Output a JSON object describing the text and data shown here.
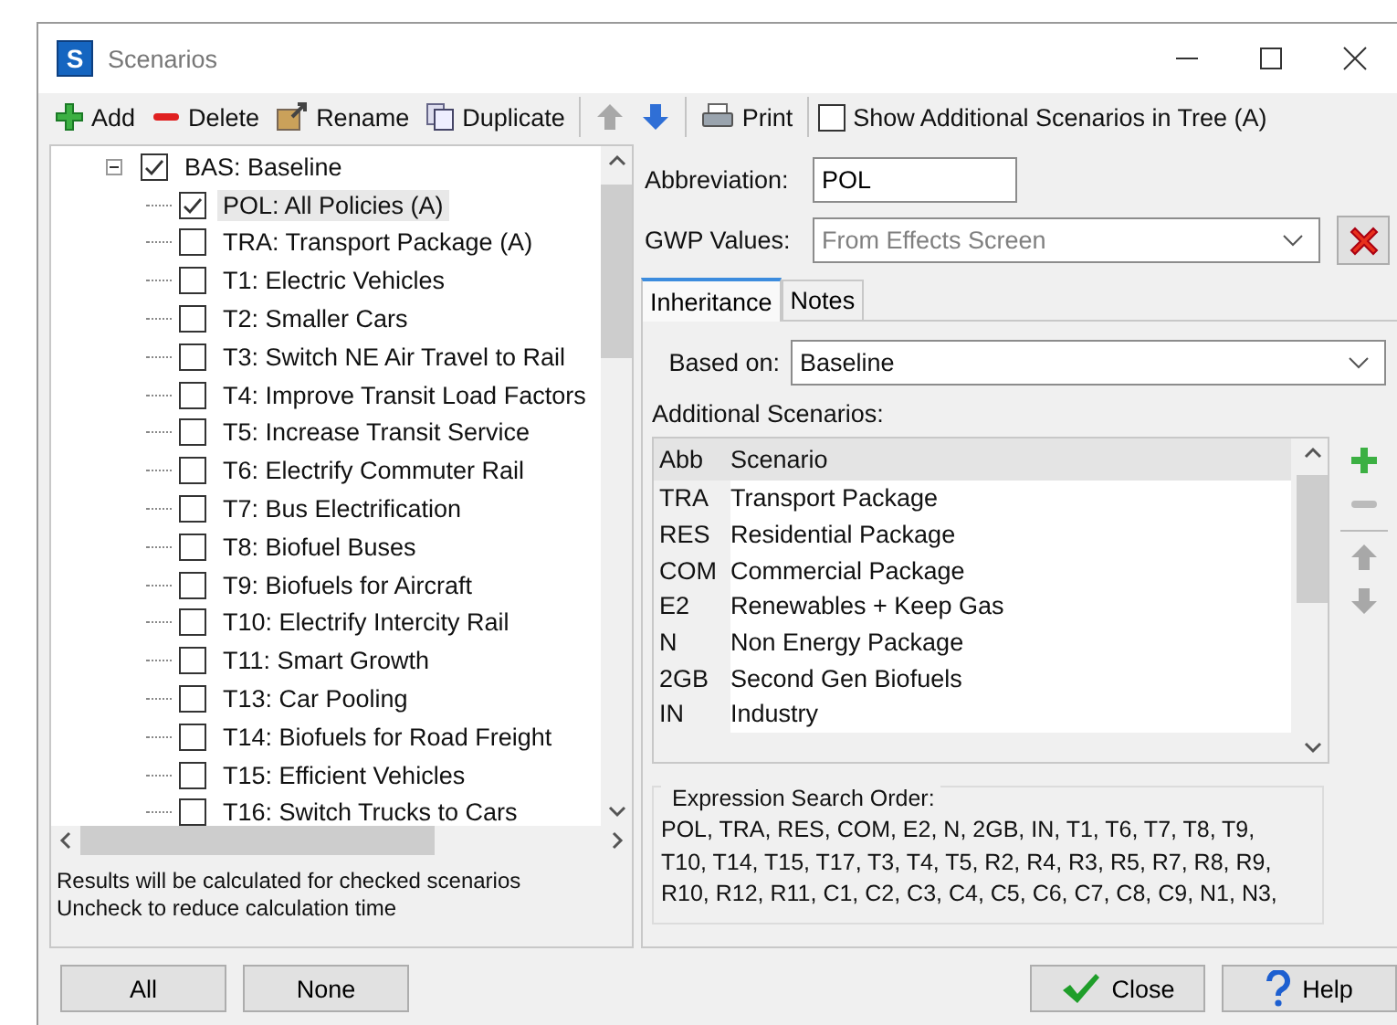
{
  "window": {
    "title": "Scenarios",
    "app_icon": "S"
  },
  "toolbar": [
    {
      "label": "Add",
      "kind": "add",
      "disabled": false
    },
    {
      "label": "Delete",
      "kind": "delete",
      "disabled": false
    },
    {
      "label": "Rename",
      "kind": "rename",
      "disabled": false
    },
    {
      "label": "Duplicate",
      "kind": "duplicate",
      "disabled": false
    },
    {
      "kind": "up",
      "disabled": true
    },
    {
      "kind": "down",
      "disabled": false
    },
    {
      "label": "Print",
      "kind": "print",
      "disabled": false
    }
  ],
  "show_additional": {
    "label": "Show Additional Scenarios in Tree (A)",
    "checked": false
  },
  "tree": [
    {
      "label": "BAS: Baseline",
      "checked": true,
      "expanded": true,
      "children": [
        {
          "label": "POL: All Policies (A)",
          "checked": true,
          "selected": true
        },
        {
          "label": "TRA: Transport Package (A)",
          "checked": false,
          "selected": false
        },
        {
          "label": "T1: Electric Vehicles",
          "checked": false,
          "selected": false
        },
        {
          "label": "T2: Smaller Cars",
          "checked": false,
          "selected": false
        },
        {
          "label": "T3: Switch NE Air Travel to Rail",
          "checked": false,
          "selected": false
        },
        {
          "label": "T4: Improve Transit Load Factors",
          "checked": false,
          "selected": false
        },
        {
          "label": "T5: Increase Transit Service",
          "checked": false,
          "selected": false
        },
        {
          "label": "T6: Electrify Commuter Rail",
          "checked": false,
          "selected": false
        },
        {
          "label": "T7: Bus Electrification",
          "checked": false,
          "selected": false
        },
        {
          "label": "T8: Biofuel Buses",
          "checked": false,
          "selected": false
        },
        {
          "label": "T9: Biofuels for Aircraft",
          "checked": false,
          "selected": false
        },
        {
          "label": "T10: Electrify Intercity Rail",
          "checked": false,
          "selected": false
        },
        {
          "label": "T11: Smart Growth",
          "checked": false,
          "selected": false
        },
        {
          "label": "T13: Car Pooling",
          "checked": false,
          "selected": false
        },
        {
          "label": "T14: Biofuels for Road Freight",
          "checked": false,
          "selected": false
        },
        {
          "label": "T15: Efficient Vehicles",
          "checked": false,
          "selected": false
        },
        {
          "label": "T16: Switch Trucks to Cars",
          "checked": false,
          "selected": false
        }
      ]
    }
  ],
  "tree_note": [
    "Results will be calculated for checked scenarios",
    "Uncheck to reduce calculation time"
  ],
  "select_buttons": [
    "All",
    "None"
  ],
  "abbreviation": {
    "label": "Abbreviation:",
    "value": "POL"
  },
  "gwp": {
    "label": "GWP Values:",
    "placeholder": "From Effects Screen"
  },
  "tabs": [
    {
      "label": "Inheritance",
      "selected": true
    },
    {
      "label": "Notes",
      "selected": false
    }
  ],
  "based_on": {
    "label": "Based on:",
    "value": "Baseline"
  },
  "additional": {
    "label": "Additional Scenarios:",
    "columns": [
      "Abb",
      "Scenario"
    ],
    "rows": [
      [
        "TRA",
        "Transport Package"
      ],
      [
        "RES",
        "Residential Package"
      ],
      [
        "COM",
        "Commercial Package"
      ],
      [
        "E2",
        "Renewables + Keep Gas"
      ],
      [
        "N",
        "Non Energy Package"
      ],
      [
        "2GB",
        "Second Gen Biofuels"
      ],
      [
        "IN",
        "Industry"
      ]
    ],
    "side_buttons": [
      {
        "kind": "add",
        "disabled": false
      },
      {
        "kind": "remove",
        "disabled": true
      },
      {
        "kind": "up",
        "disabled": true
      },
      {
        "kind": "down",
        "disabled": true
      }
    ]
  },
  "search_order": {
    "label": "Expression Search Order:",
    "lines": [
      "POL, TRA, RES, COM, E2, N, 2GB, IN, T1, T6, T7, T8, T9,",
      "T10, T14, T15, T17, T3, T4, T5, R2, R4, R3, R5, R7, R8, R9,",
      "R10, R12, R11, C1, C2, C3, C4, C5, C6, C7, C8, C9, N1, N3,"
    ]
  },
  "footer_buttons": [
    {
      "label": "Close",
      "kind": "close"
    },
    {
      "label": "Help",
      "kind": "help"
    }
  ]
}
